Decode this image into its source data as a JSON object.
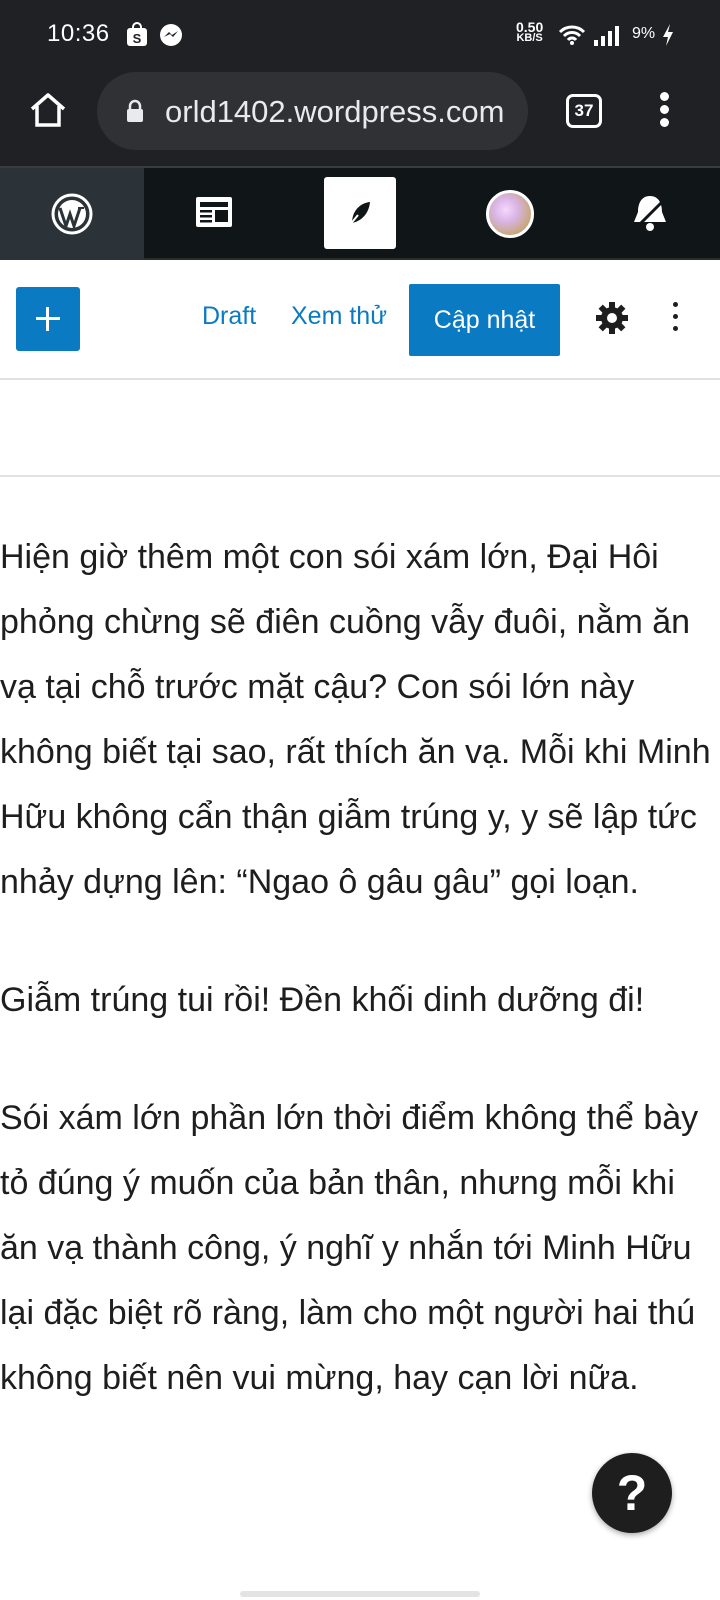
{
  "status_bar": {
    "time": "10:36",
    "net_speed_value": "0.50",
    "net_speed_unit": "KB/S",
    "battery": "9%"
  },
  "browser": {
    "url": "orld1402.wordpress.com",
    "tab_count": "37"
  },
  "editor": {
    "draft_label": "Draft",
    "preview_label": "Xem thử",
    "update_label": "Cập nhật",
    "paragraphs": [
      "Hiện giờ thêm một con sói xám lớn, Đại Hôi phỏng chừng sẽ điên cuồng vẫy đuôi, nằm ăn vạ tại chỗ trước mặt cậu? Con sói lớn này không biết tại sao, rất thích ăn vạ. Mỗi khi Minh Hữu không cẩn thận giẫm trúng y, y sẽ lập tức nhảy dựng lên: “Ngao ô gâu gâu” gọi loạn.",
      "Giẫm trúng tui rồi! Đền khối dinh dưỡng đi!",
      "Sói xám lớn phần lớn thời điểm không thể bày tỏ đúng ý muốn của bản thân, nhưng mỗi khi ăn vạ thành công, ý nghĩ y nhắn tới Minh Hữu lại đặc biệt rõ ràng, làm cho một người hai thú không biết nên vui mừng, hay cạn lời nữa."
    ],
    "help_label": "?"
  },
  "colors": {
    "accent": "#0a7ac2",
    "browser_bg": "#202124",
    "masterbar_bg": "#101517"
  }
}
